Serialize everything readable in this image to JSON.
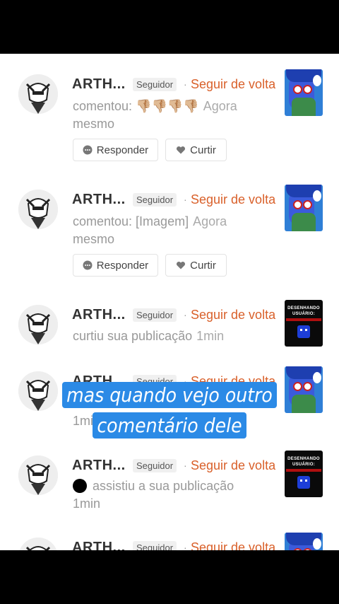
{
  "labels": {
    "badge": "Seguidor",
    "follow": "Seguir de volta",
    "reply": "Responder",
    "like": "Curtir"
  },
  "items": [
    {
      "name": "ARTH...",
      "line1": "comentou: 👎🏼👎🏼👎🏼👎🏼",
      "time": "Agora",
      "line2": "mesmo",
      "thumb": "blue"
    },
    {
      "name": "ARTH...",
      "line1": "comentou: [Imagem]",
      "time": "Agora",
      "line2": "mesmo",
      "thumb": "blue"
    },
    {
      "name": "ARTH...",
      "line1": "curtiu sua publicação",
      "time": "1min",
      "line2": "",
      "thumb": "dark"
    },
    {
      "name": "ARTH...",
      "line1": "",
      "time": "",
      "line2": "1min",
      "thumb": "blue"
    },
    {
      "name": "ARTH...",
      "line1": "assistiu a sua publicação",
      "time": "",
      "line2": "1min",
      "thumb": "dark"
    },
    {
      "name": "ARTH...",
      "line1": "",
      "time": "",
      "line2": "",
      "thumb": "blue"
    }
  ],
  "thumb_title": "DESENHANDO USUÁRIO:",
  "overlay_caption": "mas quando vejo outro comentário dele"
}
